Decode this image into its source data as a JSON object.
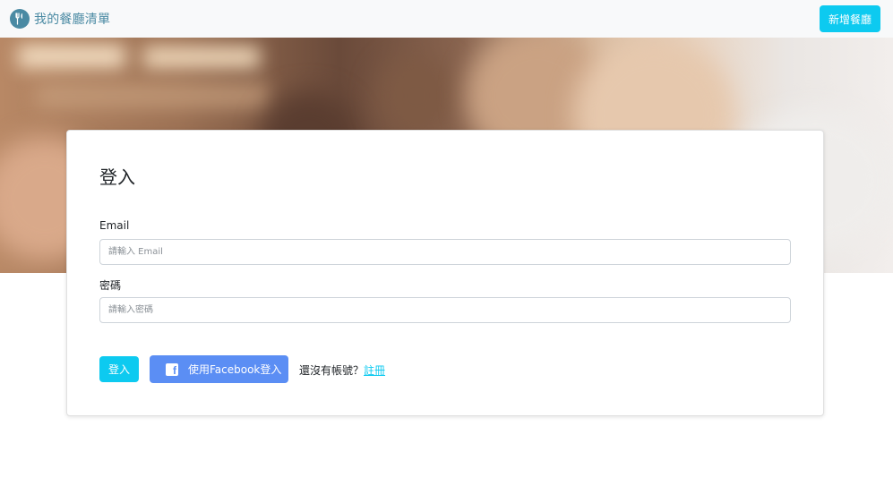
{
  "navbar": {
    "brand_text": "我的餐廳清單",
    "brand_icon": "utensils-icon",
    "add_button_label": "新增餐廳"
  },
  "hero": {
    "description_colors": [
      "#b88865",
      "#6a4a3a",
      "#d8ba9e",
      "#f2eeec"
    ]
  },
  "login_card": {
    "title": "登入",
    "email": {
      "label": "Email",
      "placeholder": "請輸入 Email",
      "value": ""
    },
    "password": {
      "label": "密碼",
      "placeholder": "請輸入密碼",
      "value": ""
    },
    "login_button_label": "登入",
    "facebook_button": {
      "label": "使用Facebook登入",
      "icon": "facebook-icon"
    },
    "signup_prompt": "還沒有帳號？",
    "signup_link_label": "註冊"
  },
  "colors": {
    "accent": "#0dcaf0",
    "facebook": "#5b8ef4",
    "brand": "#4a8aa3"
  }
}
